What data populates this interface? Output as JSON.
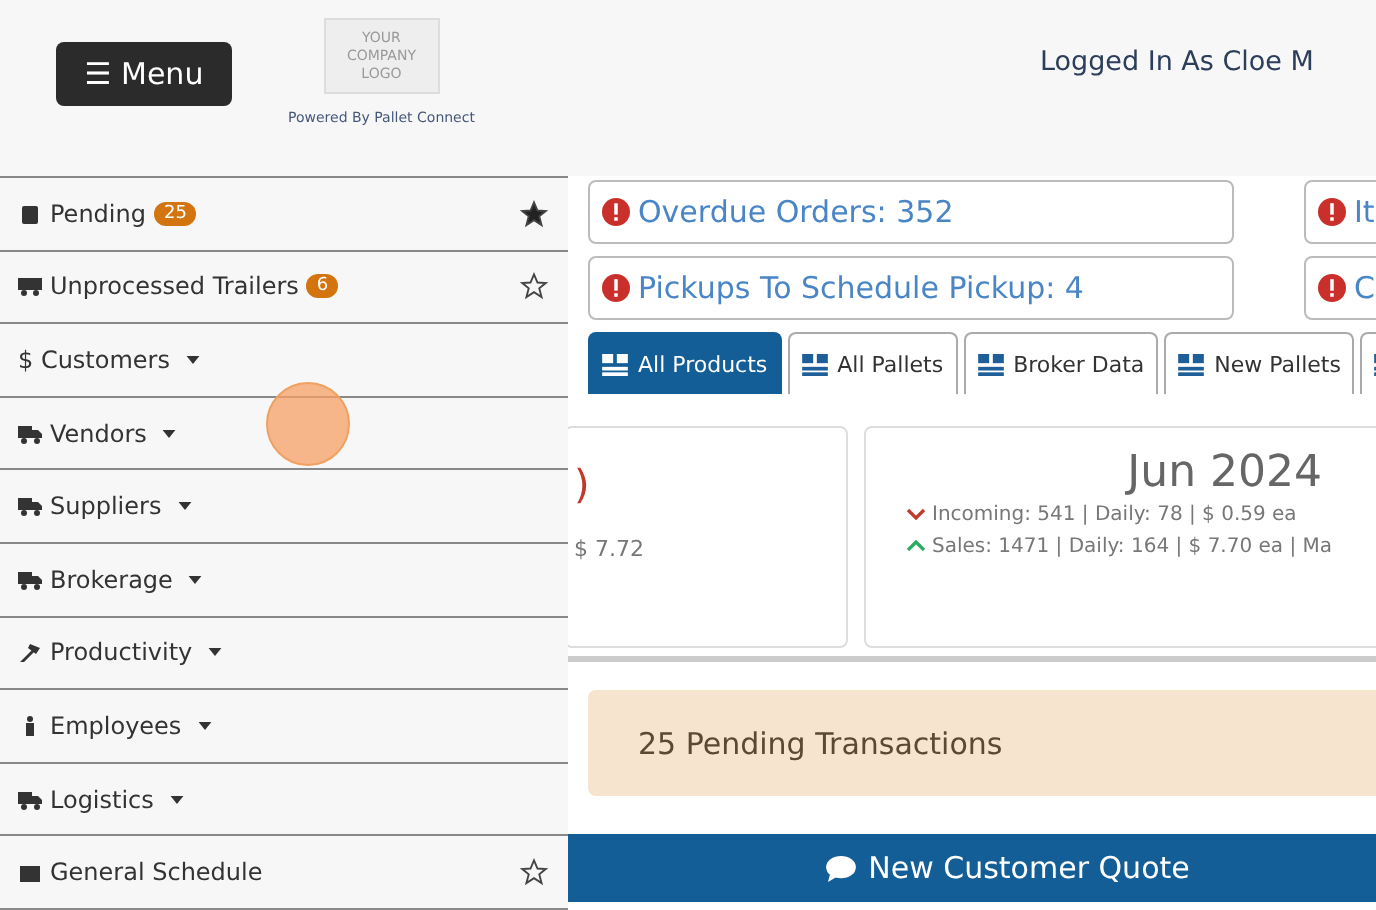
{
  "header": {
    "menu_button": "☰ Menu",
    "logo_lines": [
      "YOUR",
      "COMPANY",
      "LOGO"
    ],
    "powered_by": "Powered By Pallet Connect",
    "user": "Logged In As Cloe M"
  },
  "sidebar": {
    "items": [
      {
        "label": "Pending",
        "badge": "25",
        "dropdown": false,
        "favorite": true
      },
      {
        "label": "Unprocessed Trailers",
        "badge": "6",
        "dropdown": false,
        "favorite": false
      },
      {
        "label": "$ Customers",
        "dropdown": true
      },
      {
        "label": "Vendors",
        "dropdown": true
      },
      {
        "label": "Suppliers",
        "dropdown": true
      },
      {
        "label": "Brokerage",
        "dropdown": true
      },
      {
        "label": "Productivity",
        "dropdown": true
      },
      {
        "label": "Employees",
        "dropdown": true
      },
      {
        "label": "Logistics",
        "dropdown": true
      },
      {
        "label": "General Schedule",
        "dropdown": false,
        "favorite": false
      }
    ]
  },
  "alerts": [
    {
      "text": "Overdue Orders: 352"
    },
    {
      "text": "It"
    },
    {
      "text": "Pickups To Schedule Pickup: 4"
    },
    {
      "text": "C"
    }
  ],
  "tabs": [
    {
      "label": "All Products",
      "selected": true
    },
    {
      "label": "All Pallets",
      "selected": false
    },
    {
      "label": "Broker Data",
      "selected": false
    },
    {
      "label": "New Pallets",
      "selected": false
    },
    {
      "selected": false
    }
  ],
  "stats": {
    "left": {
      "partial_title": ")",
      "line": "$ 7.72"
    },
    "right": {
      "title": "Jun 2024",
      "incoming": "Incoming: 541 | Daily: 78 | $ 0.59 ea",
      "sales": "Sales: 1471 | Daily: 164 | $ 7.70 ea | Ma"
    }
  },
  "pending_banner": "25 Pending Transactions",
  "quote_button": "New Customer Quote"
}
